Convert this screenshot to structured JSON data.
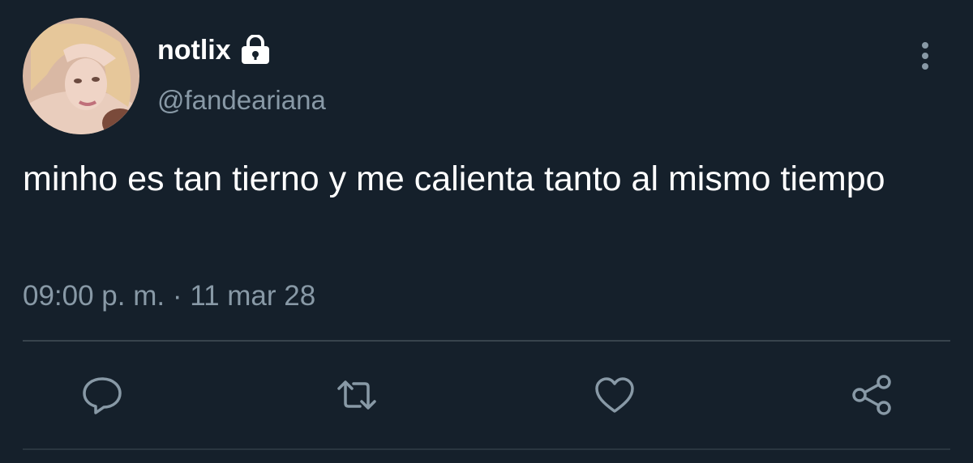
{
  "user": {
    "display_name": "notlix",
    "handle": "@fandeariana",
    "protected_icon": "lock-icon",
    "avatar": "avatar-photo"
  },
  "tweet": {
    "text": "minho es tan tierno y me calienta tanto al mismo tiempo",
    "timestamp": "09:00 p. m. · 11 mar 28"
  },
  "actions": [
    {
      "name": "reply",
      "icon": "speech-bubble-icon"
    },
    {
      "name": "retweet",
      "icon": "retweet-icon"
    },
    {
      "name": "like",
      "icon": "heart-icon"
    },
    {
      "name": "share",
      "icon": "share-icon"
    }
  ],
  "more_icon": "vertical-dots-icon",
  "colors": {
    "background": "#15202b",
    "primary_text": "#ffffff",
    "secondary_text": "#8899a6",
    "divider": "#38444d"
  }
}
